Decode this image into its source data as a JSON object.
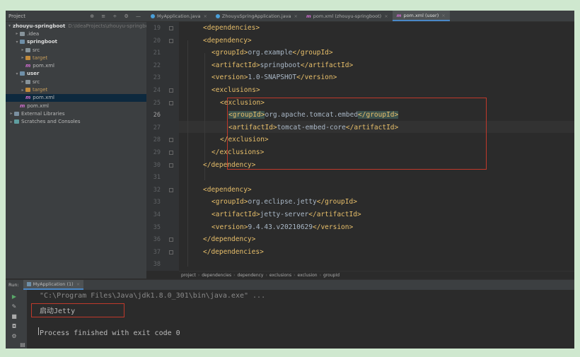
{
  "project": {
    "header_title": "Project",
    "tree": [
      {
        "label": "zhouyu-springboot",
        "path": "D:\\IdeaProjects\\zhouyu-springbo",
        "depth": 0,
        "icon": "module",
        "arrow": "v",
        "bold": true
      },
      {
        "label": ".idea",
        "depth": 1,
        "icon": "folder",
        "arrow": ">"
      },
      {
        "label": "springboot",
        "depth": 1,
        "icon": "module",
        "arrow": "v",
        "bold": true
      },
      {
        "label": "src",
        "depth": 2,
        "icon": "folder",
        "arrow": ">"
      },
      {
        "label": "target",
        "depth": 2,
        "icon": "folder-orange",
        "arrow": ">",
        "orange": true
      },
      {
        "label": "pom.xml",
        "depth": 2,
        "icon": "m"
      },
      {
        "label": "user",
        "depth": 1,
        "icon": "module",
        "arrow": "v",
        "bold": true
      },
      {
        "label": "src",
        "depth": 2,
        "icon": "folder",
        "arrow": ">"
      },
      {
        "label": "target",
        "depth": 2,
        "icon": "folder-orange",
        "arrow": ">",
        "orange": true
      },
      {
        "label": "pom.xml",
        "depth": 2,
        "icon": "m",
        "selected": true
      },
      {
        "label": "pom.xml",
        "depth": 1,
        "icon": "m"
      },
      {
        "label": "External Libraries",
        "depth": 0,
        "icon": "lib",
        "arrow": ">"
      },
      {
        "label": "Scratches and Consoles",
        "depth": 0,
        "icon": "scratch",
        "arrow": ">"
      }
    ]
  },
  "tabs": [
    {
      "label": "MyApplication.java",
      "icon": "java",
      "color": "#4a9fd8"
    },
    {
      "label": "ZhouyuSpringApplication.java",
      "icon": "java",
      "color": "#4a9fd8"
    },
    {
      "label": "pom.xml (zhouyu-springboot)",
      "icon": "m"
    },
    {
      "label": "pom.xml (user)",
      "icon": "m",
      "active": true
    }
  ],
  "editor": {
    "current_line": "26",
    "lines": [
      {
        "n": "19",
        "tag1": "<dependencies>",
        "txt": "",
        "tag2": ""
      },
      {
        "n": "20",
        "tag1": "<dependency>",
        "txt": "",
        "tag2": ""
      },
      {
        "n": "21",
        "tag1": "<groupId>",
        "txt": "org.example",
        "tag2": "</groupId>"
      },
      {
        "n": "22",
        "tag1": "<artifactId>",
        "txt": "springboot",
        "tag2": "</artifactId>"
      },
      {
        "n": "23",
        "tag1": "<version>",
        "txt": "1.0-SNAPSHOT",
        "tag2": "</version>"
      },
      {
        "n": "24",
        "tag1": "<exclusions>",
        "txt": "",
        "tag2": ""
      },
      {
        "n": "25",
        "tag1": "<exclusion>",
        "txt": "",
        "tag2": ""
      },
      {
        "n": "26",
        "tag1": "<groupId>",
        "txt": "org.apache.tomcat.embed",
        "tag2": "</groupId>"
      },
      {
        "n": "27",
        "tag1": "<artifactId>",
        "txt": "tomcat-embed-core",
        "tag2": "</artifactId>"
      },
      {
        "n": "28",
        "tag1": "</exclusion>",
        "txt": "",
        "tag2": ""
      },
      {
        "n": "29",
        "tag1": "</exclusions>",
        "txt": "",
        "tag2": ""
      },
      {
        "n": "30",
        "tag1": "</dependency>",
        "txt": "",
        "tag2": ""
      },
      {
        "n": "31",
        "tag1": "",
        "txt": "",
        "tag2": ""
      },
      {
        "n": "32",
        "tag1": "<dependency>",
        "txt": "",
        "tag2": ""
      },
      {
        "n": "33",
        "tag1": "<groupId>",
        "txt": "org.eclipse.jetty",
        "tag2": "</groupId>"
      },
      {
        "n": "34",
        "tag1": "<artifactId>",
        "txt": "jetty-server",
        "tag2": "</artifactId>"
      },
      {
        "n": "35",
        "tag1": "<version>",
        "txt": "9.4.43.v20210629",
        "tag2": "</version>"
      },
      {
        "n": "36",
        "tag1": "</dependency>",
        "txt": "",
        "tag2": ""
      },
      {
        "n": "37",
        "tag1": "</dependencies>",
        "txt": "",
        "tag2": ""
      },
      {
        "n": "38",
        "tag1": "",
        "txt": "",
        "tag2": ""
      }
    ]
  },
  "breadcrumb": [
    "project",
    "dependencies",
    "dependency",
    "exclusions",
    "exclusion",
    "groupId"
  ],
  "run": {
    "label": "Run:",
    "tab": "MyApplication (1)",
    "console": [
      "\"C:\\Program Files\\Java\\jdk1.8.0_301\\bin\\java.exe\" ...",
      "启动Jetty",
      "Process finished with exit code 0"
    ]
  },
  "colors": {
    "tag": "#e8bf6a",
    "text": "#a9b7c6",
    "highlight_box": "#c0392b",
    "background": "#2b2b2b"
  }
}
